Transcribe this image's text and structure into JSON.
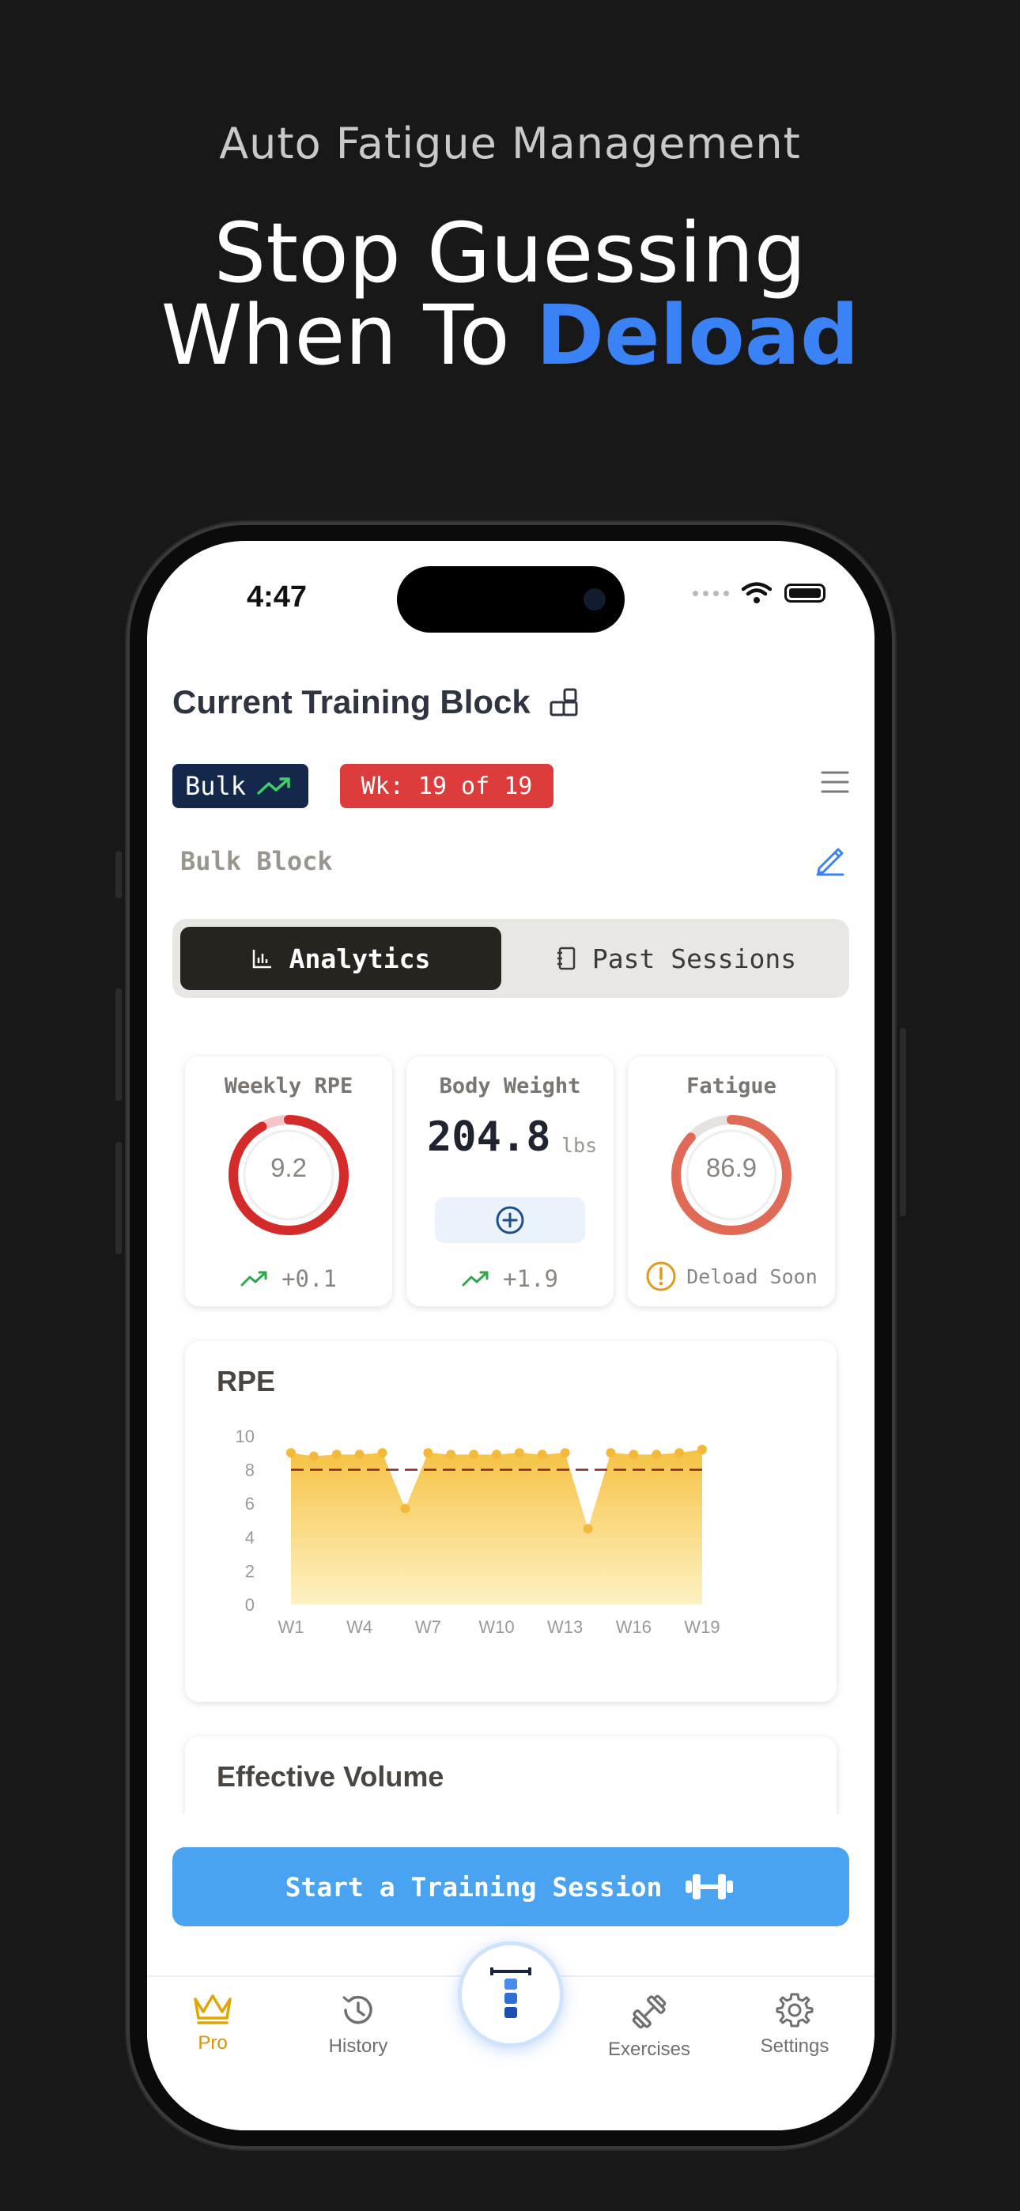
{
  "hero": {
    "subtitle": "Auto Fatigue Management",
    "title_line1": "Stop Guessing",
    "title_line2_prefix": "When To ",
    "title_line2_accent": "Deload"
  },
  "status_bar": {
    "time": "4:47"
  },
  "header": {
    "title": "Current Training Block",
    "phase_badge": "Bulk",
    "week_badge": "Wk: 19 of 19",
    "block_name": "Bulk Block"
  },
  "tabs": {
    "analytics": "Analytics",
    "past_sessions": "Past Sessions"
  },
  "stats": {
    "weekly_rpe": {
      "label": "Weekly RPE",
      "value": "9.2",
      "change": "+0.1",
      "ring_fraction": 0.92
    },
    "body_weight": {
      "label": "Body Weight",
      "value": "204.8",
      "unit": "lbs",
      "change": "+1.9"
    },
    "fatigue": {
      "label": "Fatigue",
      "value": "86.9",
      "status": "Deload Soon",
      "ring_fraction": 0.869
    }
  },
  "chart_data": {
    "type": "area",
    "title": "RPE",
    "x": [
      "W1",
      "W2",
      "W3",
      "W4",
      "W5",
      "W6",
      "W7",
      "W8",
      "W9",
      "W10",
      "W11",
      "W12",
      "W13",
      "W14",
      "W15",
      "W16",
      "W17",
      "W18",
      "W19"
    ],
    "xticks": [
      "W1",
      "W4",
      "W7",
      "W10",
      "W13",
      "W16",
      "W19"
    ],
    "yticks": [
      "0",
      "2",
      "4",
      "6",
      "8",
      "10"
    ],
    "ylim": [
      0,
      10
    ],
    "values": [
      9,
      8.8,
      8.9,
      8.9,
      9,
      5.7,
      9,
      8.9,
      8.9,
      8.9,
      9,
      8.9,
      9,
      4.5,
      9,
      8.9,
      8.9,
      9,
      9.2
    ],
    "target_line": 8,
    "colors": {
      "fill_top": "#f6c244",
      "fill_bottom": "#fdf2c4",
      "point": "#f5b93a",
      "target": "#8b2a2a"
    }
  },
  "effective_volume": {
    "title": "Effective Volume"
  },
  "cta": {
    "label": "Start a Training Session"
  },
  "tabbar": {
    "pro": "Pro",
    "history": "History",
    "exercises": "Exercises",
    "settings": "Settings"
  },
  "colors": {
    "accent_blue": "#3b82f6",
    "badge_navy": "#14284b",
    "badge_red": "#dc3c3c",
    "cta_blue": "#4aa3f0",
    "pro_gold": "#d99400"
  }
}
